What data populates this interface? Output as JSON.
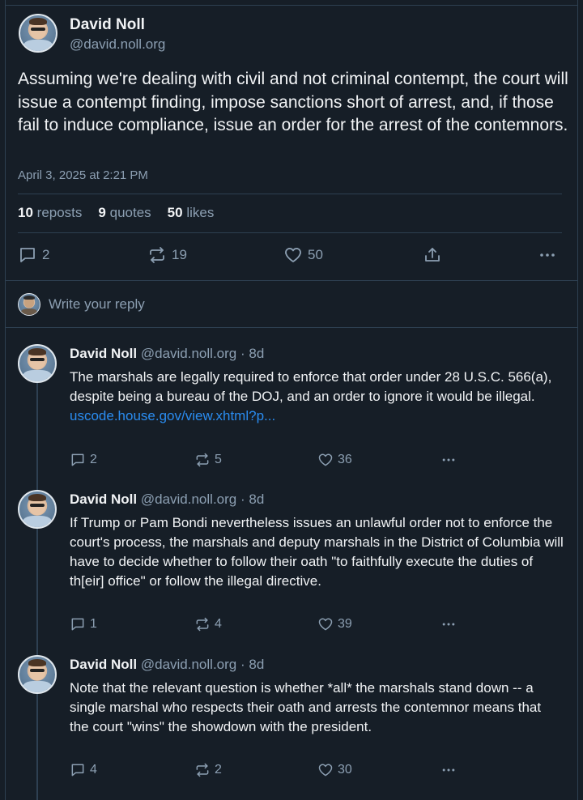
{
  "main_post": {
    "author_name": "David Noll",
    "author_handle": "@david.noll.org",
    "text": "Assuming we're dealing with civil and not criminal contempt, the court will issue a contempt finding, impose sanctions short of arrest, and, if those fail to induce compliance, issue an order for the arrest of the contemnors.",
    "timestamp": "April 3, 2025 at 2:21 PM",
    "stats": {
      "reposts_count": "10",
      "reposts_label": "reposts",
      "quotes_count": "9",
      "quotes_label": "quotes",
      "likes_count": "50",
      "likes_label": "likes"
    },
    "actions": {
      "replies": "2",
      "reposts": "19",
      "likes": "50"
    }
  },
  "reply_box": {
    "placeholder": "Write your reply"
  },
  "thread": [
    {
      "author_name": "David Noll",
      "author_handle": "@david.noll.org",
      "age": "· 8d",
      "text": "The marshals are legally required to enforce that order under 28 U.S.C. 566(a), despite being a bureau of the DOJ, and an order to ignore it would be illegal.",
      "link": "uscode.house.gov/view.xhtml?p...",
      "replies": "2",
      "reposts": "5",
      "likes": "36"
    },
    {
      "author_name": "David Noll",
      "author_handle": "@david.noll.org",
      "age": "· 8d",
      "text": "If Trump or Pam Bondi nevertheless issues an unlawful order not to enforce the court's process, the marshals and deputy marshals in the District of Columbia will have to decide whether to follow their oath \"to faithfully execute the duties of th[eir] office\" or follow the illegal directive.",
      "replies": "1",
      "reposts": "4",
      "likes": "39"
    },
    {
      "author_name": "David Noll",
      "author_handle": "@david.noll.org",
      "age": "· 8d",
      "text": "Note that the relevant question is whether *all* the marshals stand down -- a single marshal who respects their oath and arrests the contemnor means that the court \"wins\" the showdown with the president.",
      "replies": "4",
      "reposts": "2",
      "likes": "30"
    }
  ],
  "icons": {
    "reply": "speech-bubble-icon",
    "repost": "repost-arrows-icon",
    "like": "heart-icon",
    "share": "share-upload-icon",
    "more": "more-dots-icon"
  },
  "colors": {
    "background": "#161e27",
    "text": "#f1f3f5",
    "muted": "#8c9fb2",
    "link": "#2a8cf0",
    "border": "#2e4052"
  }
}
